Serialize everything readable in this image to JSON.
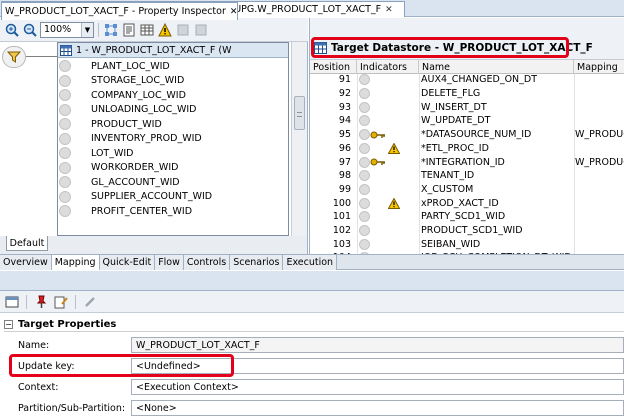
{
  "editor_tab": {
    "title": "SDE_ORA_ProductLotTransactionFact_Delete_UPG.W_PRODUCT_LOT_XACT_F",
    "close": "✕"
  },
  "toolbar": {
    "zoom": "100%"
  },
  "entity": {
    "title": "1 - W_PRODUCT_LOT_XACT_F (W",
    "columns": [
      "PLANT_LOC_WID",
      "STORAGE_LOC_WID",
      "COMPANY_LOC_WID",
      "UNLOADING_LOC_WID",
      "PRODUCT_WID",
      "INVENTORY_PROD_WID",
      "LOT_WID",
      "WORKORDER_WID",
      "GL_ACCOUNT_WID",
      "SUPPLIER_ACCOUNT_WID",
      "PROFIT_CENTER_WID"
    ]
  },
  "default_tab": "Default",
  "target": {
    "title": "Target Datastore - W_PRODUCT_LOT_XACT_F",
    "headers": {
      "position": "Position",
      "indicators": "Indicators",
      "name": "Name",
      "mapping": "Mapping"
    },
    "rows": [
      {
        "pos": "91",
        "name": "AUX4_CHANGED_ON_DT",
        "key": false,
        "warn": false,
        "mapping": ""
      },
      {
        "pos": "92",
        "name": "DELETE_FLG",
        "key": false,
        "warn": false,
        "mapping": ""
      },
      {
        "pos": "93",
        "name": "W_INSERT_DT",
        "key": false,
        "warn": false,
        "mapping": ""
      },
      {
        "pos": "94",
        "name": "W_UPDATE_DT",
        "key": false,
        "warn": false,
        "mapping": ""
      },
      {
        "pos": "95",
        "name": "*DATASOURCE_NUM_ID",
        "key": true,
        "warn": false,
        "mapping": "W_PRODUC"
      },
      {
        "pos": "96",
        "name": "*ETL_PROC_ID",
        "key": false,
        "warn": true,
        "mapping": ""
      },
      {
        "pos": "97",
        "name": "*INTEGRATION_ID",
        "key": true,
        "warn": false,
        "mapping": "W_PRODUC"
      },
      {
        "pos": "98",
        "name": "TENANT_ID",
        "key": false,
        "warn": false,
        "mapping": ""
      },
      {
        "pos": "99",
        "name": "X_CUSTOM",
        "key": false,
        "warn": false,
        "mapping": ""
      },
      {
        "pos": "100",
        "name": "xPROD_XACT_ID",
        "key": false,
        "warn": true,
        "mapping": ""
      },
      {
        "pos": "101",
        "name": "PARTY_SCD1_WID",
        "key": false,
        "warn": false,
        "mapping": ""
      },
      {
        "pos": "102",
        "name": "PRODUCT_SCD1_WID",
        "key": false,
        "warn": false,
        "mapping": ""
      },
      {
        "pos": "103",
        "name": "SEIBAN_WID",
        "key": false,
        "warn": false,
        "mapping": ""
      },
      {
        "pos": "104",
        "name": "JOB_SCH_COMPLETION_DT_WID",
        "key": false,
        "warn": false,
        "mapping": ""
      }
    ]
  },
  "lower_tabs": [
    "Overview",
    "Mapping",
    "Quick-Edit",
    "Flow",
    "Controls",
    "Scenarios",
    "Execution"
  ],
  "active_lower_tab": "Mapping",
  "inspector": {
    "title": "W_PRODUCT_LOT_XACT_F - Property Inspector",
    "close": "✕",
    "section": "Target Properties",
    "name_label": "Name:",
    "name_value": "W_PRODUCT_LOT_XACT_F",
    "update_key_label": "Update key:",
    "update_key_value": "<Undefined>",
    "context_label": "Context:",
    "context_value": "<Execution Context>",
    "partition_label": "Partition/Sub-Partition:",
    "partition_value": "<None>"
  },
  "colors": {
    "highlight": "#e2001a",
    "panel_header": "#dbe6f3"
  }
}
